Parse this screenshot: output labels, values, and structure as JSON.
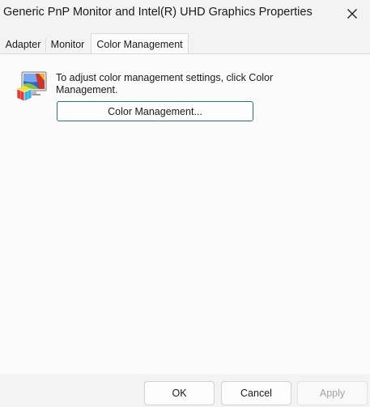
{
  "window": {
    "title": "Generic PnP Monitor and Intel(R) UHD Graphics Properties",
    "close_icon": "close-icon"
  },
  "tabs": [
    {
      "label": "Adapter",
      "active": false
    },
    {
      "label": "Monitor",
      "active": false
    },
    {
      "label": "Color Management",
      "active": true
    }
  ],
  "color_management": {
    "icon": "color-management-icon",
    "description": "To adjust color management settings, click Color Management.",
    "button_label": "Color Management..."
  },
  "footer": {
    "ok_label": "OK",
    "cancel_label": "Cancel",
    "apply_label": "Apply",
    "apply_enabled": false
  },
  "colors": {
    "accent_border": "#2a6f7a",
    "chrome_background": "#f3f3f3",
    "panel_background": "#fbfbfb"
  }
}
